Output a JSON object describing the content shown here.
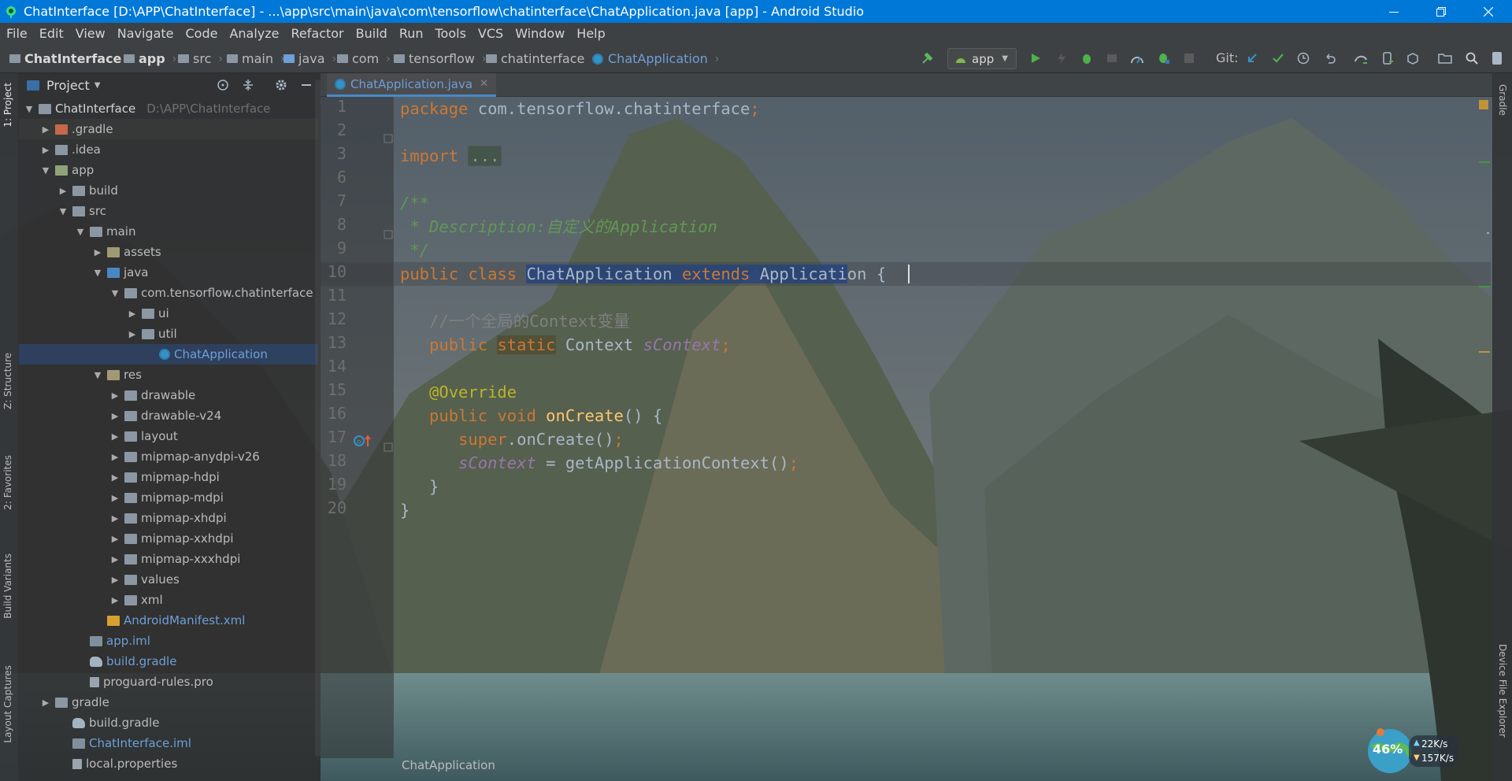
{
  "window": {
    "title": "ChatInterface [D:\\APP\\ChatInterface] - ...\\app\\src\\main\\java\\com\\tensorflow\\chatinterface\\ChatApplication.java [app] - Android Studio"
  },
  "menu": [
    "File",
    "Edit",
    "View",
    "Navigate",
    "Code",
    "Analyze",
    "Refactor",
    "Build",
    "Run",
    "Tools",
    "VCS",
    "Window",
    "Help"
  ],
  "breadcrumbs": [
    "ChatInterface",
    "app",
    "src",
    "main",
    "java",
    "com",
    "tensorflow",
    "chatinterface",
    "ChatApplication"
  ],
  "toolbar": {
    "run_config": "app",
    "git_label": "Git:"
  },
  "tool_tabs": {
    "left": [
      "1: Project",
      "Z: Structure",
      "2: Favorites",
      "Build Variants",
      "Layout Captures"
    ],
    "right": [
      "Gradle",
      "Device File Explorer"
    ]
  },
  "project_panel": {
    "header": "Project"
  },
  "tree": [
    {
      "label": "ChatInterface",
      "hint": "D:\\APP\\ChatInterface"
    },
    {
      "label": ".gradle"
    },
    {
      "label": ".idea"
    },
    {
      "label": "app"
    },
    {
      "label": "build"
    },
    {
      "label": "src"
    },
    {
      "label": "main"
    },
    {
      "label": "assets"
    },
    {
      "label": "java"
    },
    {
      "label": "com.tensorflow.chatinterface"
    },
    {
      "label": "ui"
    },
    {
      "label": "util"
    },
    {
      "label": "ChatApplication"
    },
    {
      "label": "res"
    },
    {
      "label": "drawable"
    },
    {
      "label": "drawable-v24"
    },
    {
      "label": "layout"
    },
    {
      "label": "mipmap-anydpi-v26"
    },
    {
      "label": "mipmap-hdpi"
    },
    {
      "label": "mipmap-mdpi"
    },
    {
      "label": "mipmap-xhdpi"
    },
    {
      "label": "mipmap-xxhdpi"
    },
    {
      "label": "mipmap-xxxhdpi"
    },
    {
      "label": "values"
    },
    {
      "label": "xml"
    },
    {
      "label": "AndroidManifest.xml"
    },
    {
      "label": "app.iml"
    },
    {
      "label": "build.gradle"
    },
    {
      "label": "proguard-rules.pro"
    },
    {
      "label": "gradle"
    },
    {
      "label": "build.gradle"
    },
    {
      "label": "ChatInterface.iml"
    },
    {
      "label": "local.properties"
    }
  ],
  "editor": {
    "tab_label": "ChatApplication.java",
    "line_numbers": [
      "1",
      "2",
      "3",
      "6",
      "7",
      "8",
      "9",
      "10",
      "11",
      "12",
      "13",
      "14",
      "15",
      "16",
      "17",
      "18",
      "19",
      "20",
      "",
      ""
    ],
    "bottom_breadcrumb": "ChatApplication"
  },
  "code": {
    "l1": {
      "kw": "package",
      "pkg": "com.tensorflow.chatinterface"
    },
    "l3": {
      "kw": "import",
      "folded": "..."
    },
    "l6": "/**",
    "l7": " * Description:自定义的Application",
    "l8": " */",
    "l9": {
      "kw1": "public",
      "kw2": "class",
      "name": "ChatApplication",
      "kw3": "extends",
      "sel_tail": "Applicati",
      "rest": "on"
    },
    "l11": "//一个全局的Context变量",
    "l12": {
      "kw1": "public",
      "kw2": "static",
      "type": "Context",
      "field": "sContext"
    },
    "l14": "@Override",
    "l15": {
      "kw1": "public",
      "kw2": "void",
      "fn": "onCreate",
      "rest": "() {"
    },
    "l16": {
      "kw": "super",
      "rest": ".onCreate()"
    },
    "l17": {
      "field": "sContext",
      "rest": " = getApplicationContext()"
    },
    "l18": "}",
    "l19": "}"
  },
  "widget": {
    "percent": "46%",
    "up": "22K/s",
    "down": "157K/s"
  }
}
